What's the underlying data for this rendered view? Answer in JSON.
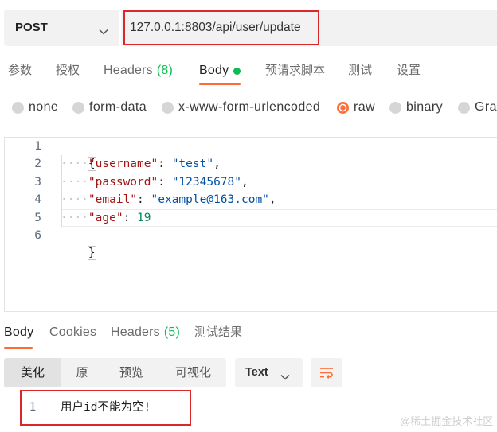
{
  "colors": {
    "accent": "#ff6c37",
    "count_green": "#0cbb52",
    "annotation_red": "#d8282c",
    "json_key": "#a31515",
    "json_string": "#0451a5",
    "json_number": "#098658"
  },
  "icons": {
    "method_dropdown": "chevron-down-icon",
    "body_indicator": "dot-icon",
    "format_dropdown": "chevron-down-icon",
    "wrap_lines": "wrap-lines-icon"
  },
  "request": {
    "method": "POST",
    "url": "127.0.0.1:8803/api/user/update"
  },
  "request_tabs": [
    {
      "label": "参数"
    },
    {
      "label": "授权"
    },
    {
      "label": "Headers",
      "count": "(8)"
    },
    {
      "label": "Body",
      "active": true,
      "has_content": true
    },
    {
      "label": "预请求脚本"
    },
    {
      "label": "测试"
    },
    {
      "label": "设置"
    }
  ],
  "body_types": [
    {
      "label": "none"
    },
    {
      "label": "form-data"
    },
    {
      "label": "x-www-form-urlencoded"
    },
    {
      "label": "raw",
      "selected": true
    },
    {
      "label": "binary"
    },
    {
      "label": "Grap"
    }
  ],
  "editor": {
    "whitespace_marker": "····",
    "lines": [
      {
        "number": "1",
        "open_brace": "{"
      },
      {
        "number": "2",
        "key": "\"username\"",
        "separator": ": ",
        "value": "\"test\"",
        "comma": ","
      },
      {
        "number": "3",
        "key": "\"password\"",
        "separator": ": ",
        "value": "\"12345678\"",
        "comma": ","
      },
      {
        "number": "4",
        "key": "\"email\"",
        "separator": ": ",
        "value": "\"example@163.com\"",
        "comma": ","
      },
      {
        "number": "5",
        "key": "\"age\"",
        "separator": ": ",
        "value": "19",
        "current": true
      },
      {
        "number": "6",
        "close_brace": "}"
      }
    ]
  },
  "response": {
    "tabs": [
      {
        "label": "Body",
        "active": true
      },
      {
        "label": "Cookies"
      },
      {
        "label": "Headers",
        "count": "(5)"
      },
      {
        "label": "测试结果"
      }
    ],
    "view_modes": [
      {
        "label": "美化",
        "active": true
      },
      {
        "label": "原"
      },
      {
        "label": "预览"
      },
      {
        "label": "可视化"
      }
    ],
    "format": "Text",
    "lines": [
      {
        "number": "1",
        "text": "用户id不能为空!"
      }
    ]
  },
  "watermark": "@稀土掘金技术社区"
}
